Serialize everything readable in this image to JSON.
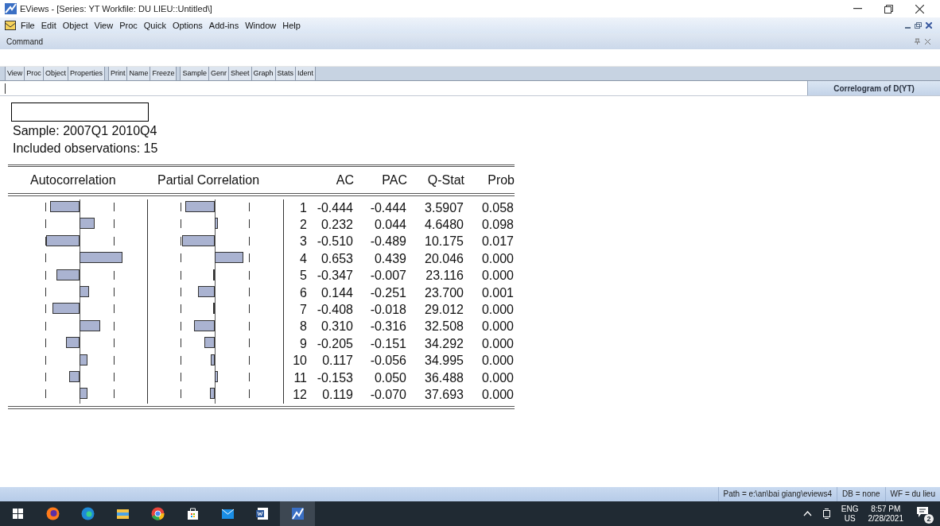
{
  "window": {
    "title": "EViews - [Series: YT   Workfile: DU LIEU::Untitled\\]"
  },
  "menu": [
    "File",
    "Edit",
    "Object",
    "View",
    "Proc",
    "Quick",
    "Options",
    "Add-ins",
    "Window",
    "Help"
  ],
  "command_pane": {
    "title": "Command"
  },
  "toolbar": [
    [
      "View",
      "Proc",
      "Object",
      "Properties"
    ],
    [
      "Print",
      "Name",
      "Freeze"
    ],
    [
      "Sample",
      "Genr",
      "Sheet",
      "Graph",
      "Stats",
      "Ident"
    ]
  ],
  "tabs": [
    {
      "label": "Correlogram of D(YT)",
      "selected": true
    }
  ],
  "output": {
    "sample": "Sample: 2007Q1 2010Q4",
    "observations": "Included observations: 15",
    "columns": [
      "Autocorrelation",
      "Partial Correlation",
      "AC",
      "PAC",
      "Q-Stat",
      "Prob"
    ],
    "rows": [
      {
        "lag": "1",
        "ac": "-0.444",
        "pac": "-0.444",
        "q_stat": "3.5907",
        "prob": "0.058"
      },
      {
        "lag": "2",
        "ac": "0.232",
        "pac": "0.044",
        "q_stat": "4.6480",
        "prob": "0.098"
      },
      {
        "lag": "3",
        "ac": "-0.510",
        "pac": "-0.489",
        "q_stat": "10.175",
        "prob": "0.017"
      },
      {
        "lag": "4",
        "ac": "0.653",
        "pac": "0.439",
        "q_stat": "20.046",
        "prob": "0.000"
      },
      {
        "lag": "5",
        "ac": "-0.347",
        "pac": "-0.007",
        "q_stat": "23.116",
        "prob": "0.000"
      },
      {
        "lag": "6",
        "ac": "0.144",
        "pac": "-0.251",
        "q_stat": "23.700",
        "prob": "0.001"
      },
      {
        "lag": "7",
        "ac": "-0.408",
        "pac": "-0.018",
        "q_stat": "29.012",
        "prob": "0.000"
      },
      {
        "lag": "8",
        "ac": "0.310",
        "pac": "-0.316",
        "q_stat": "32.508",
        "prob": "0.000"
      },
      {
        "lag": "9",
        "ac": "-0.205",
        "pac": "-0.151",
        "q_stat": "34.292",
        "prob": "0.000"
      },
      {
        "lag": "10",
        "ac": "0.117",
        "pac": "-0.056",
        "q_stat": "34.995",
        "prob": "0.000"
      },
      {
        "lag": "11",
        "ac": "-0.153",
        "pac": "0.050",
        "q_stat": "36.488",
        "prob": "0.000"
      },
      {
        "lag": "12",
        "ac": "0.119",
        "pac": "-0.070",
        "q_stat": "37.693",
        "prob": "0.000"
      }
    ]
  },
  "status_bar": [
    "Path = e:\\an\\bai giang\\eviews4",
    "DB = none",
    "WF = du lieu"
  ],
  "taskbar": {
    "language": "ENG",
    "region": "US",
    "time": "8:57 PM",
    "date": "2/28/2021",
    "notifications": "2"
  }
}
